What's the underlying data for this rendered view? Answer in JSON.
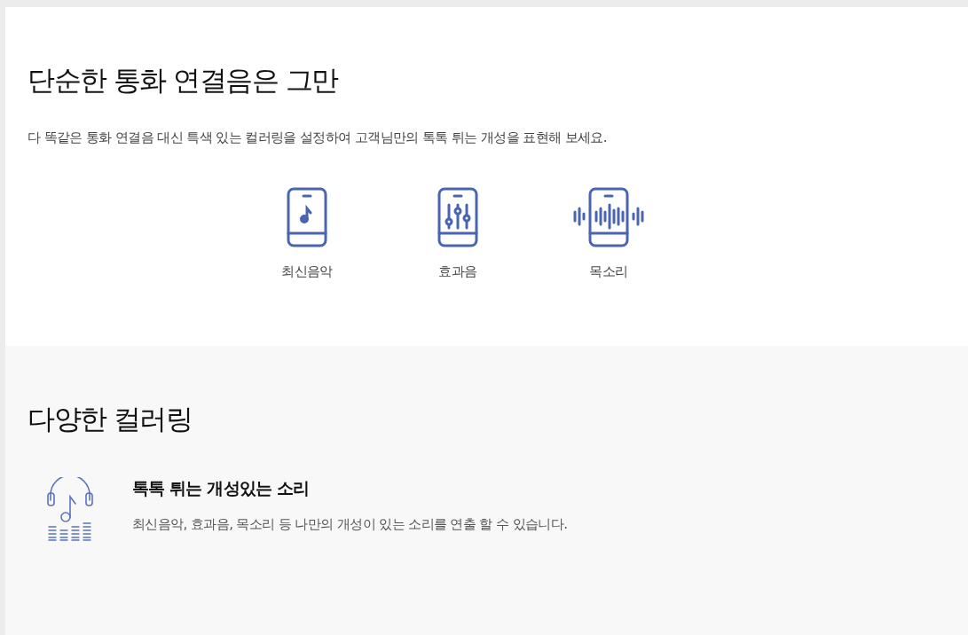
{
  "intro": {
    "title": "단순한 통화 연결음은 그만",
    "description": "다 똑같은 통화 연결음 대신 특색 있는 컬러링을 설정하여 고객님만의 톡톡 튀는 개성을 표현해 보세요.",
    "categories": [
      {
        "kind": "music",
        "label": "최신음악"
      },
      {
        "kind": "effects",
        "label": "효과음"
      },
      {
        "kind": "voice",
        "label": "목소리"
      }
    ]
  },
  "variety": {
    "title": "다양한 컬러링",
    "features": [
      {
        "title": "톡톡 튀는 개성있는 소리",
        "description": "최신음악, 효과음, 목소리 등 나만의 개성이 있는 소리를 연출 할 수 있습니다."
      }
    ]
  }
}
